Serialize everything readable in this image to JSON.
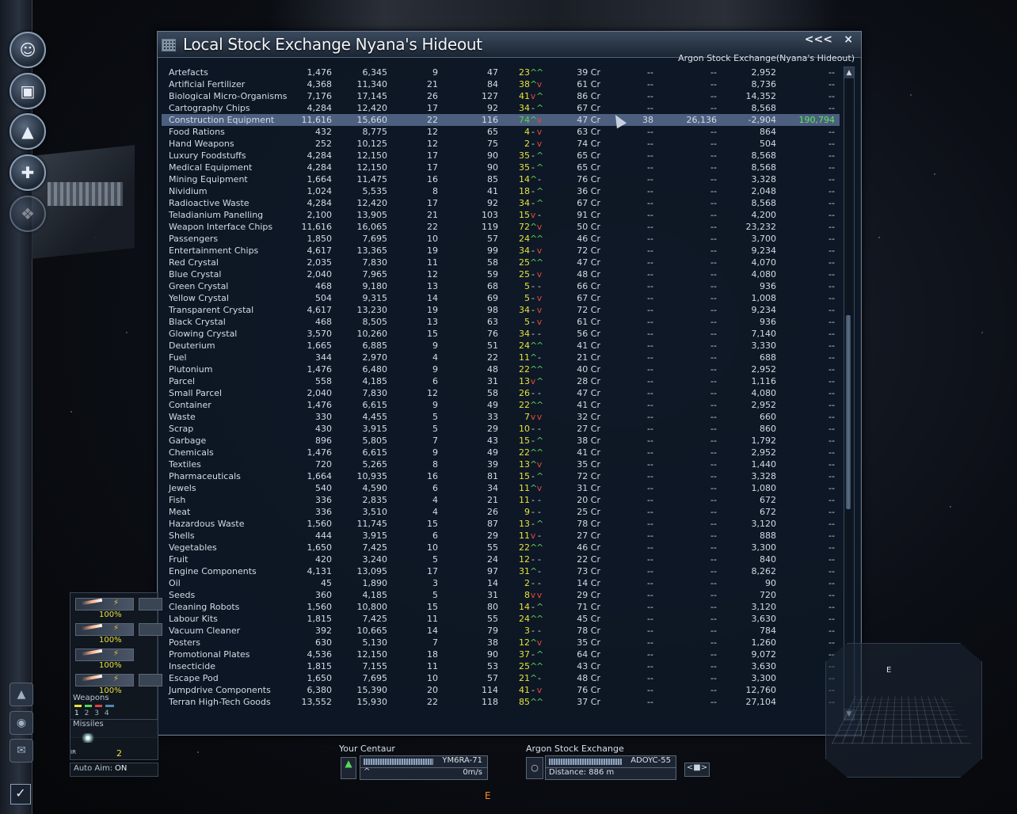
{
  "window": {
    "title": "Local Stock Exchange Nyana's Hideout",
    "subtitle": "Argon Stock Exchange(Nyana's Hideout)",
    "collapse_label": "<<<",
    "close_label": "×"
  },
  "scroll": {
    "up": "▲",
    "down": "▼"
  },
  "rows": [
    {
      "name": "Artefacts",
      "n1": "1,476",
      "n2": "6,345",
      "n3": "9",
      "n4": "47",
      "p": "23",
      "a": "^",
      "b": "^",
      "cr": "39 Cr",
      "d1": "--",
      "d2": "--",
      "d3": "2,952",
      "d4": "--"
    },
    {
      "name": "Artificial Fertilizer",
      "n1": "4,368",
      "n2": "11,340",
      "n3": "21",
      "n4": "84",
      "p": "38",
      "a": "^",
      "b": "v",
      "cr": "61 Cr",
      "d1": "--",
      "d2": "--",
      "d3": "8,736",
      "d4": "--"
    },
    {
      "name": "Biological Micro-Organisms",
      "n1": "7,176",
      "n2": "17,145",
      "n3": "26",
      "n4": "127",
      "p": "41",
      "a": "v",
      "b": "^",
      "cr": "86 Cr",
      "d1": "--",
      "d2": "--",
      "d3": "14,352",
      "d4": "--"
    },
    {
      "name": "Cartography Chips",
      "n1": "4,284",
      "n2": "12,420",
      "n3": "17",
      "n4": "92",
      "p": "34",
      "a": "-",
      "b": "^",
      "cr": "67 Cr",
      "d1": "--",
      "d2": "--",
      "d3": "8,568",
      "d4": "--"
    },
    {
      "name": "Construction Equipment",
      "n1": "11,616",
      "n2": "15,660",
      "n3": "22",
      "n4": "116",
      "p": "74",
      "a": "^",
      "b": "v",
      "cr": "47 Cr",
      "d1": "38",
      "d2": "26,136",
      "d3": "-2,904",
      "d4": "190,794",
      "sel": true
    },
    {
      "name": "Food Rations",
      "n1": "432",
      "n2": "8,775",
      "n3": "12",
      "n4": "65",
      "p": "4",
      "a": "-",
      "b": "v",
      "cr": "63 Cr",
      "d1": "--",
      "d2": "--",
      "d3": "864",
      "d4": "--"
    },
    {
      "name": "Hand Weapons",
      "n1": "252",
      "n2": "10,125",
      "n3": "12",
      "n4": "75",
      "p": "2",
      "a": "-",
      "b": "v",
      "cr": "74 Cr",
      "d1": "--",
      "d2": "--",
      "d3": "504",
      "d4": "--"
    },
    {
      "name": "Luxury Foodstuffs",
      "n1": "4,284",
      "n2": "12,150",
      "n3": "17",
      "n4": "90",
      "p": "35",
      "a": "-",
      "b": "^",
      "cr": "65 Cr",
      "d1": "--",
      "d2": "--",
      "d3": "8,568",
      "d4": "--"
    },
    {
      "name": "Medical Equipment",
      "n1": "4,284",
      "n2": "12,150",
      "n3": "17",
      "n4": "90",
      "p": "35",
      "a": "-",
      "b": "^",
      "cr": "65 Cr",
      "d1": "--",
      "d2": "--",
      "d3": "8,568",
      "d4": "--"
    },
    {
      "name": "Mining Equipment",
      "n1": "1,664",
      "n2": "11,475",
      "n3": "16",
      "n4": "85",
      "p": "14",
      "a": "^",
      "b": "-",
      "cr": "76 Cr",
      "d1": "--",
      "d2": "--",
      "d3": "3,328",
      "d4": "--"
    },
    {
      "name": "Nividium",
      "n1": "1,024",
      "n2": "5,535",
      "n3": "8",
      "n4": "41",
      "p": "18",
      "a": "-",
      "b": "^",
      "cr": "36 Cr",
      "d1": "--",
      "d2": "--",
      "d3": "2,048",
      "d4": "--"
    },
    {
      "name": "Radioactive Waste",
      "n1": "4,284",
      "n2": "12,420",
      "n3": "17",
      "n4": "92",
      "p": "34",
      "a": "-",
      "b": "^",
      "cr": "67 Cr",
      "d1": "--",
      "d2": "--",
      "d3": "8,568",
      "d4": "--"
    },
    {
      "name": "Teladianium Panelling",
      "n1": "2,100",
      "n2": "13,905",
      "n3": "21",
      "n4": "103",
      "p": "15",
      "a": "v",
      "b": "-",
      "cr": "91 Cr",
      "d1": "--",
      "d2": "--",
      "d3": "4,200",
      "d4": "--"
    },
    {
      "name": "Weapon Interface Chips",
      "n1": "11,616",
      "n2": "16,065",
      "n3": "22",
      "n4": "119",
      "p": "72",
      "a": "^",
      "b": "v",
      "cr": "50 Cr",
      "d1": "--",
      "d2": "--",
      "d3": "23,232",
      "d4": "--"
    },
    {
      "name": "Passengers",
      "n1": "1,850",
      "n2": "7,695",
      "n3": "10",
      "n4": "57",
      "p": "24",
      "a": "^",
      "b": "^",
      "cr": "46 Cr",
      "d1": "--",
      "d2": "--",
      "d3": "3,700",
      "d4": "--"
    },
    {
      "name": "Entertainment Chips",
      "n1": "4,617",
      "n2": "13,365",
      "n3": "19",
      "n4": "99",
      "p": "34",
      "a": "-",
      "b": "v",
      "cr": "72 Cr",
      "d1": "--",
      "d2": "--",
      "d3": "9,234",
      "d4": "--"
    },
    {
      "name": "Red Crystal",
      "n1": "2,035",
      "n2": "7,830",
      "n3": "11",
      "n4": "58",
      "p": "25",
      "a": "^",
      "b": "^",
      "cr": "47 Cr",
      "d1": "--",
      "d2": "--",
      "d3": "4,070",
      "d4": "--"
    },
    {
      "name": "Blue Crystal",
      "n1": "2,040",
      "n2": "7,965",
      "n3": "12",
      "n4": "59",
      "p": "25",
      "a": "-",
      "b": "v",
      "cr": "48 Cr",
      "d1": "--",
      "d2": "--",
      "d3": "4,080",
      "d4": "--"
    },
    {
      "name": "Green Crystal",
      "n1": "468",
      "n2": "9,180",
      "n3": "13",
      "n4": "68",
      "p": "5",
      "a": "-",
      "b": "-",
      "cr": "66 Cr",
      "d1": "--",
      "d2": "--",
      "d3": "936",
      "d4": "--"
    },
    {
      "name": "Yellow Crystal",
      "n1": "504",
      "n2": "9,315",
      "n3": "14",
      "n4": "69",
      "p": "5",
      "a": "-",
      "b": "v",
      "cr": "67 Cr",
      "d1": "--",
      "d2": "--",
      "d3": "1,008",
      "d4": "--"
    },
    {
      "name": "Transparent Crystal",
      "n1": "4,617",
      "n2": "13,230",
      "n3": "19",
      "n4": "98",
      "p": "34",
      "a": "-",
      "b": "v",
      "cr": "72 Cr",
      "d1": "--",
      "d2": "--",
      "d3": "9,234",
      "d4": "--"
    },
    {
      "name": "Black Crystal",
      "n1": "468",
      "n2": "8,505",
      "n3": "13",
      "n4": "63",
      "p": "5",
      "a": "-",
      "b": "v",
      "cr": "61 Cr",
      "d1": "--",
      "d2": "--",
      "d3": "936",
      "d4": "--"
    },
    {
      "name": "Glowing Crystal",
      "n1": "3,570",
      "n2": "10,260",
      "n3": "15",
      "n4": "76",
      "p": "34",
      "a": "-",
      "b": "-",
      "cr": "56 Cr",
      "d1": "--",
      "d2": "--",
      "d3": "7,140",
      "d4": "--"
    },
    {
      "name": "Deuterium",
      "n1": "1,665",
      "n2": "6,885",
      "n3": "9",
      "n4": "51",
      "p": "24",
      "a": "^",
      "b": "^",
      "cr": "41 Cr",
      "d1": "--",
      "d2": "--",
      "d3": "3,330",
      "d4": "--"
    },
    {
      "name": "Fuel",
      "n1": "344",
      "n2": "2,970",
      "n3": "4",
      "n4": "22",
      "p": "11",
      "a": "^",
      "b": "-",
      "cr": "21 Cr",
      "d1": "--",
      "d2": "--",
      "d3": "688",
      "d4": "--"
    },
    {
      "name": "Plutonium",
      "n1": "1,476",
      "n2": "6,480",
      "n3": "9",
      "n4": "48",
      "p": "22",
      "a": "^",
      "b": "^",
      "cr": "40 Cr",
      "d1": "--",
      "d2": "--",
      "d3": "2,952",
      "d4": "--"
    },
    {
      "name": "Parcel",
      "n1": "558",
      "n4": "31",
      "n2": "4,185",
      "n3": "6",
      "p": "13",
      "a": "v",
      "b": "^",
      "cr": "28 Cr",
      "d1": "--",
      "d2": "--",
      "d3": "1,116",
      "d4": "--"
    },
    {
      "name": "Small Parcel",
      "n1": "2,040",
      "n2": "7,830",
      "n3": "12",
      "n4": "58",
      "p": "26",
      "a": "-",
      "b": "-",
      "cr": "47 Cr",
      "d1": "--",
      "d2": "--",
      "d3": "4,080",
      "d4": "--"
    },
    {
      "name": "Container",
      "n1": "1,476",
      "n2": "6,615",
      "n3": "9",
      "n4": "49",
      "p": "22",
      "a": "^",
      "b": "^",
      "cr": "41 Cr",
      "d1": "--",
      "d2": "--",
      "d3": "2,952",
      "d4": "--"
    },
    {
      "name": "Waste",
      "n1": "330",
      "n2": "4,455",
      "n3": "5",
      "n4": "33",
      "p": "7",
      "a": "v",
      "b": "v",
      "cr": "32 Cr",
      "d1": "--",
      "d2": "--",
      "d3": "660",
      "d4": "--"
    },
    {
      "name": "Scrap",
      "n1": "430",
      "n2": "3,915",
      "n3": "5",
      "n4": "29",
      "p": "10",
      "a": "-",
      "b": "-",
      "cr": "27 Cr",
      "d1": "--",
      "d2": "--",
      "d3": "860",
      "d4": "--"
    },
    {
      "name": "Garbage",
      "n1": "896",
      "n2": "5,805",
      "n3": "7",
      "n4": "43",
      "p": "15",
      "a": "-",
      "b": "^",
      "cr": "38 Cr",
      "d1": "--",
      "d2": "--",
      "d3": "1,792",
      "d4": "--"
    },
    {
      "name": "Chemicals",
      "n1": "1,476",
      "n2": "6,615",
      "n3": "9",
      "n4": "49",
      "p": "22",
      "a": "^",
      "b": "^",
      "cr": "41 Cr",
      "d1": "--",
      "d2": "--",
      "d3": "2,952",
      "d4": "--"
    },
    {
      "name": "Textiles",
      "n1": "720",
      "n2": "5,265",
      "n3": "8",
      "n4": "39",
      "p": "13",
      "a": "^",
      "b": "v",
      "cr": "35 Cr",
      "d1": "--",
      "d2": "--",
      "d3": "1,440",
      "d4": "--"
    },
    {
      "name": "Pharmaceuticals",
      "n1": "1,664",
      "n2": "10,935",
      "n3": "16",
      "n4": "81",
      "p": "15",
      "a": "-",
      "b": "^",
      "cr": "72 Cr",
      "d1": "--",
      "d2": "--",
      "d3": "3,328",
      "d4": "--"
    },
    {
      "name": "Jewels",
      "n1": "540",
      "n2": "4,590",
      "n3": "6",
      "n4": "34",
      "p": "11",
      "a": "^",
      "b": "v",
      "cr": "31 Cr",
      "d1": "--",
      "d2": "--",
      "d3": "1,080",
      "d4": "--"
    },
    {
      "name": "Fish",
      "n1": "336",
      "n2": "2,835",
      "n3": "4",
      "n4": "21",
      "p": "11",
      "a": "-",
      "b": "-",
      "cr": "20 Cr",
      "d1": "--",
      "d2": "--",
      "d3": "672",
      "d4": "--"
    },
    {
      "name": "Meat",
      "n1": "336",
      "n2": "3,510",
      "n3": "4",
      "n4": "26",
      "p": "9",
      "a": "-",
      "b": "-",
      "cr": "25 Cr",
      "d1": "--",
      "d2": "--",
      "d3": "672",
      "d4": "--"
    },
    {
      "name": "Hazardous Waste",
      "n1": "1,560",
      "n2": "11,745",
      "n3": "15",
      "n4": "87",
      "p": "13",
      "a": "-",
      "b": "^",
      "cr": "78 Cr",
      "d1": "--",
      "d2": "--",
      "d3": "3,120",
      "d4": "--"
    },
    {
      "name": "Shells",
      "n1": "444",
      "n2": "3,915",
      "n3": "6",
      "n4": "29",
      "p": "11",
      "a": "v",
      "b": "-",
      "cr": "27 Cr",
      "d1": "--",
      "d2": "--",
      "d3": "888",
      "d4": "--"
    },
    {
      "name": "Vegetables",
      "n1": "1,650",
      "n2": "7,425",
      "n3": "10",
      "n4": "55",
      "p": "22",
      "a": "^",
      "b": "^",
      "cr": "46 Cr",
      "d1": "--",
      "d2": "--",
      "d3": "3,300",
      "d4": "--"
    },
    {
      "name": "Fruit",
      "n1": "420",
      "n2": "3,240",
      "n3": "5",
      "n4": "24",
      "p": "12",
      "a": "-",
      "b": "-",
      "cr": "22 Cr",
      "d1": "--",
      "d2": "--",
      "d3": "840",
      "d4": "--"
    },
    {
      "name": "Engine Components",
      "n1": "4,131",
      "n2": "13,095",
      "n3": "17",
      "n4": "97",
      "p": "31",
      "a": "^",
      "b": "-",
      "cr": "73 Cr",
      "d1": "--",
      "d2": "--",
      "d3": "8,262",
      "d4": "--"
    },
    {
      "name": "Oil",
      "n1": "45",
      "n2": "1,890",
      "n3": "3",
      "n4": "14",
      "p": "2",
      "a": "-",
      "b": "-",
      "cr": "14 Cr",
      "d1": "--",
      "d2": "--",
      "d3": "90",
      "d4": "--"
    },
    {
      "name": "Seeds",
      "n1": "360",
      "n2": "4,185",
      "n3": "5",
      "n4": "31",
      "p": "8",
      "a": "v",
      "b": "v",
      "cr": "29 Cr",
      "d1": "--",
      "d2": "--",
      "d3": "720",
      "d4": "--"
    },
    {
      "name": "Cleaning Robots",
      "n1": "1,560",
      "n2": "10,800",
      "n3": "15",
      "n4": "80",
      "p": "14",
      "a": "-",
      "b": "^",
      "cr": "71 Cr",
      "d1": "--",
      "d2": "--",
      "d3": "3,120",
      "d4": "--"
    },
    {
      "name": "Labour Kits",
      "n1": "1,815",
      "n2": "7,425",
      "n3": "11",
      "n4": "55",
      "p": "24",
      "a": "^",
      "b": "^",
      "cr": "45 Cr",
      "d1": "--",
      "d2": "--",
      "d3": "3,630",
      "d4": "--"
    },
    {
      "name": "Vacuum Cleaner",
      "n1": "392",
      "n2": "10,665",
      "n3": "14",
      "n4": "79",
      "p": "3",
      "a": "-",
      "b": "-",
      "cr": "78 Cr",
      "d1": "--",
      "d2": "--",
      "d3": "784",
      "d4": "--"
    },
    {
      "name": "Posters",
      "n1": "630",
      "n2": "5,130",
      "n3": "7",
      "n4": "38",
      "p": "12",
      "a": "^",
      "b": "v",
      "cr": "35 Cr",
      "d1": "--",
      "d2": "--",
      "d3": "1,260",
      "d4": "--"
    },
    {
      "name": "Promotional Plates",
      "n1": "4,536",
      "n2": "12,150",
      "n3": "18",
      "n4": "90",
      "p": "37",
      "a": "-",
      "b": "^",
      "cr": "64 Cr",
      "d1": "--",
      "d2": "--",
      "d3": "9,072",
      "d4": "--"
    },
    {
      "name": "Insecticide",
      "n1": "1,815",
      "n2": "7,155",
      "n3": "11",
      "n4": "53",
      "p": "25",
      "a": "^",
      "b": "^",
      "cr": "43 Cr",
      "d1": "--",
      "d2": "--",
      "d3": "3,630",
      "d4": "--"
    },
    {
      "name": "Escape Pod",
      "n1": "1,650",
      "n2": "7,695",
      "n3": "10",
      "n4": "57",
      "p": "21",
      "a": "^",
      "b": "-",
      "cr": "48 Cr",
      "d1": "--",
      "d2": "--",
      "d3": "3,300",
      "d4": "--"
    },
    {
      "name": "Jumpdrive Components",
      "n1": "6,380",
      "n2": "15,390",
      "n3": "20",
      "n4": "114",
      "p": "41",
      "a": "-",
      "b": "v",
      "cr": "76 Cr",
      "d1": "--",
      "d2": "--",
      "d3": "12,760",
      "d4": "--"
    },
    {
      "name": "Terran High-Tech Goods",
      "n1": "13,552",
      "n2": "15,930",
      "n3": "22",
      "n4": "118",
      "p": "85",
      "a": "^",
      "b": "^",
      "cr": "37 Cr",
      "d1": "--",
      "d2": "--",
      "d3": "27,104",
      "d4": "--"
    }
  ],
  "weapons": {
    "label": "Weapons",
    "slots": [
      "100%",
      "100%",
      "100%",
      "100%"
    ],
    "groups": [
      "1",
      "2",
      "3",
      "4"
    ]
  },
  "missiles": {
    "label": "Missiles",
    "type": "IR",
    "count": "2"
  },
  "autoaim": {
    "label": "Auto Aim:",
    "value": "ON"
  },
  "hud": {
    "ship_label": "Your Centaur",
    "ship_id": "YM6RA-71",
    "speed": "0m/s",
    "target_label": "Argon Stock Exchange",
    "target_id": "ADOYC-55",
    "distance": "Distance: 886 m",
    "target_marker": "E",
    "radar_marker": "E"
  },
  "colors": {
    "price_yellow": "#e6e23c",
    "up_green": "#57d257",
    "down_red": "#e04a3a",
    "profit_green": "#5ee85b",
    "selection": "#4c5f7f"
  }
}
